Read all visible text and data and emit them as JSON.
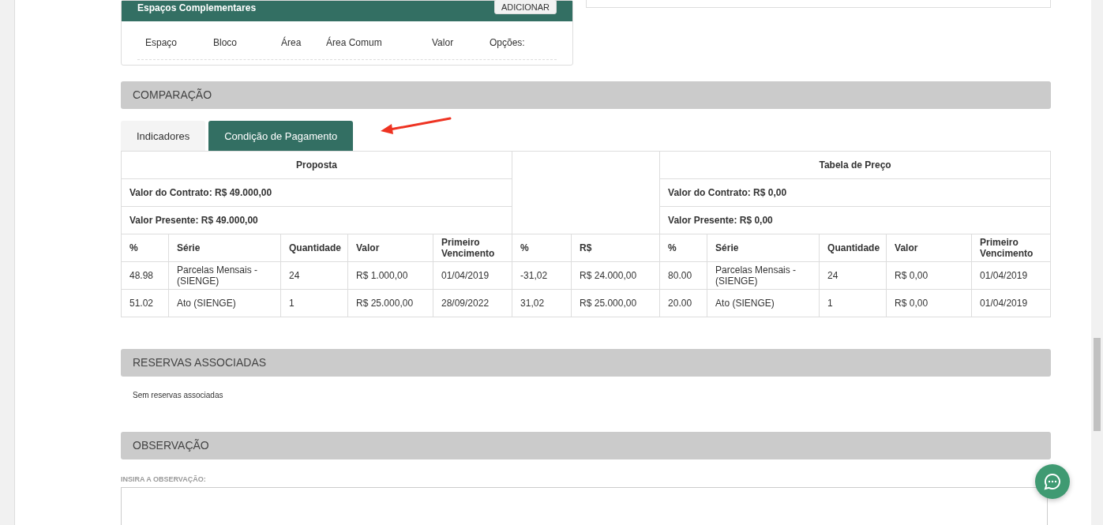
{
  "espacos": {
    "title": "Espaços Complementares",
    "button": "ADICIONAR",
    "columns": [
      "Espaço",
      "Bloco",
      "Área",
      "Área Comum",
      "Valor",
      "Opções:"
    ]
  },
  "comparacao": {
    "title": "COMPARAÇÃO",
    "tabs": [
      {
        "label": "Indicadores",
        "selected": false
      },
      {
        "label": "Condição de Pagamento",
        "selected": true
      }
    ],
    "proposta": {
      "title": "Proposta",
      "contract": "Valor do Contrato: R$ 49.000,00",
      "present": "Valor Presente: R$ 49.000,00"
    },
    "tabela": {
      "title": "Tabela de Preço",
      "contract": "Valor do Contrato: R$ 0,00",
      "present": "Valor Presente: R$ 0,00"
    },
    "columns": [
      "%",
      "Série",
      "Quantidade",
      "Valor",
      "Primeiro Vencimento",
      "%",
      "R$",
      "%",
      "Série",
      "Quantidade",
      "Valor",
      "Primeiro Vencimento"
    ],
    "rows": [
      [
        "48.98",
        "Parcelas Mensais - (SIENGE)",
        "24",
        "R$ 1.000,00",
        "01/04/2019",
        "-31,02",
        "R$ 24.000,00",
        "80.00",
        "Parcelas Mensais - (SIENGE)",
        "24",
        "R$ 0,00",
        "01/04/2019"
      ],
      [
        "51.02",
        "Ato (SIENGE)",
        "1",
        "R$ 25.000,00",
        "28/09/2022",
        "31,02",
        "R$ 25.000,00",
        "20.00",
        "Ato (SIENGE)",
        "1",
        "R$ 0,00",
        "01/04/2019"
      ]
    ]
  },
  "reservas": {
    "title": "RESERVAS ASSOCIADAS",
    "empty_text": "Sem reservas associadas"
  },
  "observacao": {
    "title": "OBSERVAÇÃO",
    "field_label": "INSIRA A OBSERVAÇÃO:"
  }
}
